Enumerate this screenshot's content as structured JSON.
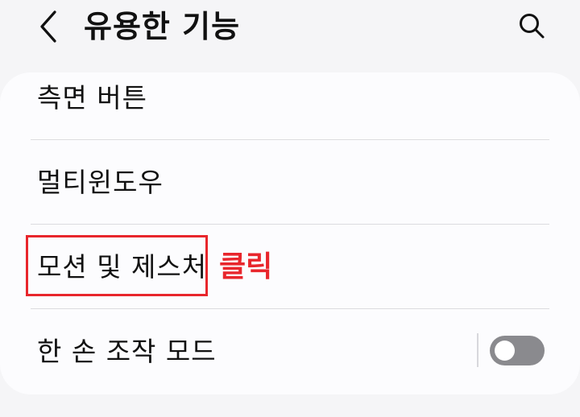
{
  "header": {
    "title": "유용한 기능",
    "back_icon": "chevron-left-icon",
    "search_icon": "search-icon"
  },
  "settings": {
    "items": [
      {
        "label": "측면 버튼"
      },
      {
        "label": "멀티윈도우"
      },
      {
        "label": "모션 및 제스처"
      },
      {
        "label": "한 손 조작 모드",
        "toggle": "off"
      }
    ]
  },
  "annotation": {
    "text": "클릭",
    "color": "#e8262c"
  }
}
